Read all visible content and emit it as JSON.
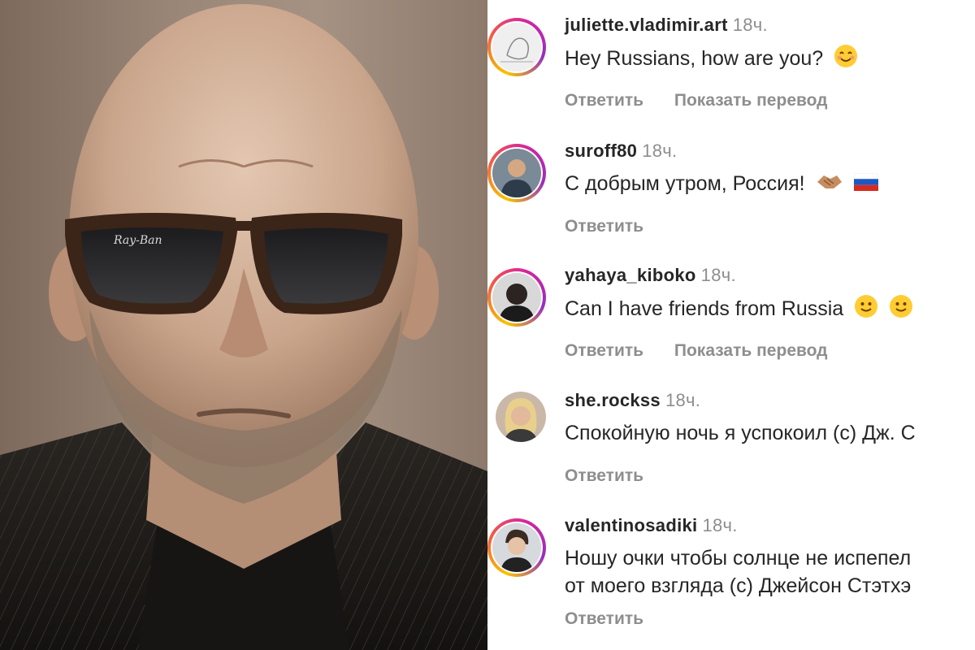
{
  "photo": {
    "description_icon": "person-photo"
  },
  "comments": [
    {
      "username": "juliette.vladimir.art",
      "time": "18ч.",
      "lines": [
        "Hey Russians, how are you?"
      ],
      "emoji": [
        "smiling-face-icon"
      ],
      "reply_label": "Ответить",
      "translate_label": "Показать перевод"
    },
    {
      "username": "suroff80",
      "time": "18ч.",
      "lines": [
        "С добрым утром, Россия!"
      ],
      "emoji": [
        "handshake-icon",
        "russia-flag-icon"
      ],
      "reply_label": "Ответить",
      "translate_label": ""
    },
    {
      "username": "yahaya_kiboko",
      "time": "18ч.",
      "lines": [
        "Can I have friends from Russia"
      ],
      "emoji": [
        "slightly-smiling-face-icon",
        "slightly-smiling-face-icon"
      ],
      "reply_label": "Ответить",
      "translate_label": "Показать перевод"
    },
    {
      "username": "she.rockss",
      "time": "18ч.",
      "lines": [
        "Спокойную ночь я успокоил (с) Дж. С"
      ],
      "emoji": [],
      "reply_label": "Ответить",
      "translate_label": ""
    },
    {
      "username": "valentinosadiki",
      "time": "18ч.",
      "lines": [
        "Ношу очки чтобы солнце не испепел",
        "от моего взгляда (с) Джейсон Стэтхэ"
      ],
      "emoji": [],
      "reply_label": "Ответить",
      "translate_label": ""
    }
  ],
  "colors": {
    "text": "#262626",
    "muted": "#8e8e8e",
    "story_ring": "#d6249f"
  }
}
